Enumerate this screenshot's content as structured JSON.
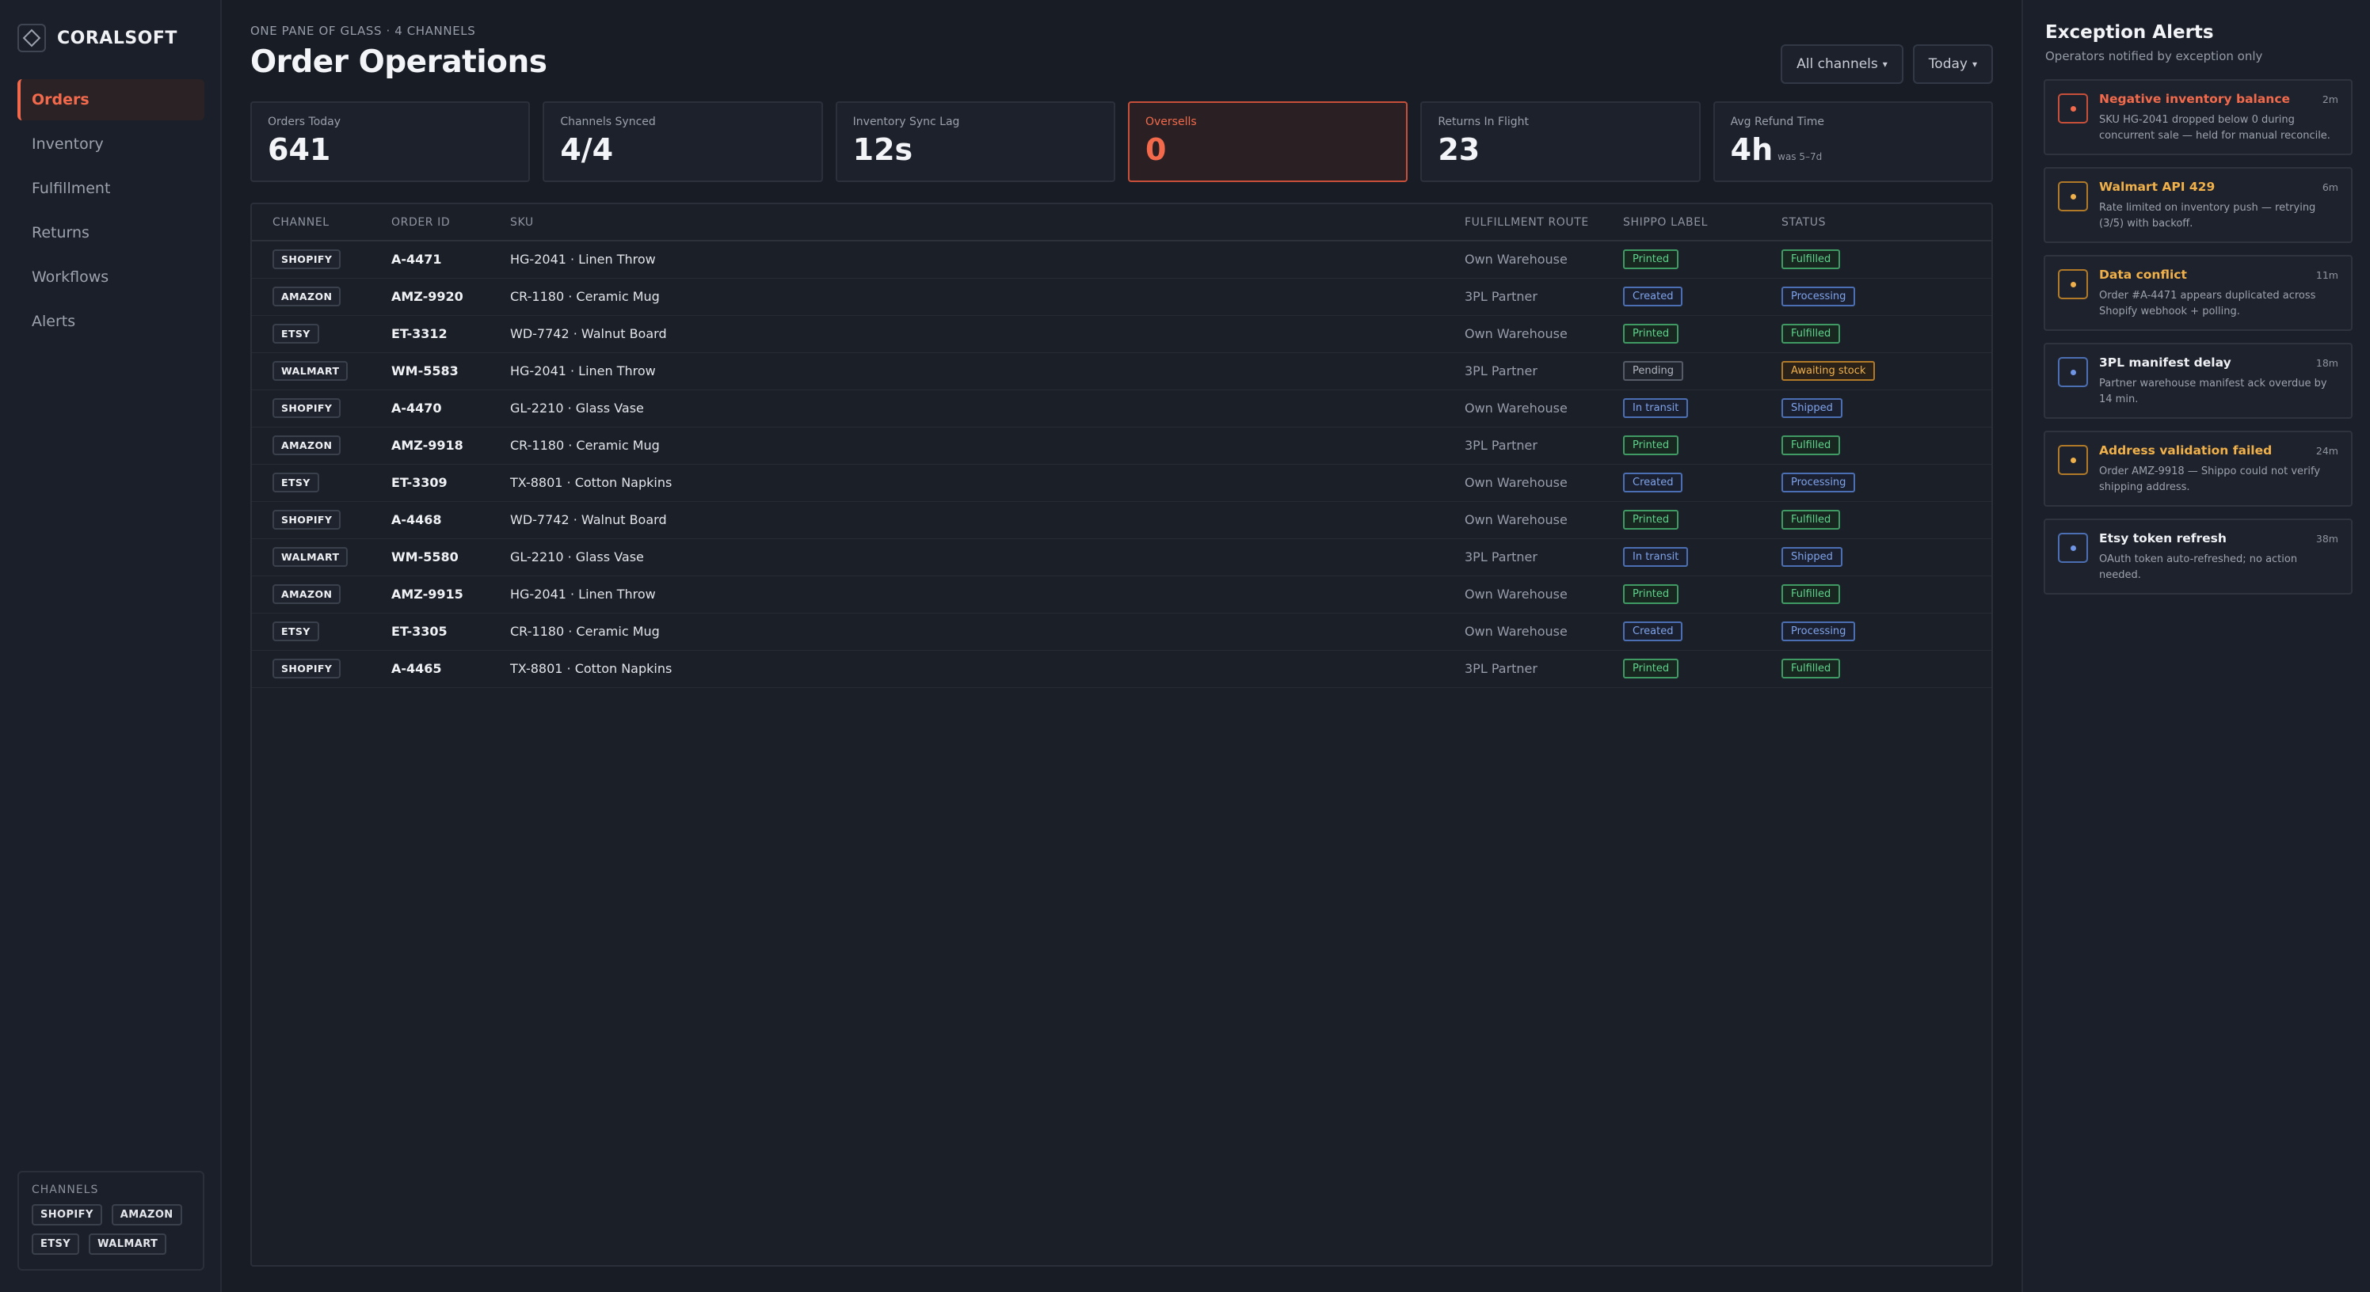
{
  "brand": {
    "name": "CORALSOFT"
  },
  "nav": [
    {
      "label": "Orders",
      "active": true
    },
    {
      "label": "Inventory"
    },
    {
      "label": "Fulfillment"
    },
    {
      "label": "Returns"
    },
    {
      "label": "Workflows"
    },
    {
      "label": "Alerts"
    }
  ],
  "channels_box": {
    "title": "CHANNELS",
    "chips": [
      "SHOPIFY",
      "AMAZON",
      "ETSY",
      "WALMART"
    ]
  },
  "header": {
    "eyebrow": "ONE PANE OF GLASS · 4 CHANNELS",
    "title": "Order Operations",
    "filter_channels": "All channels",
    "filter_date": "Today"
  },
  "kpis": [
    {
      "label": "Orders Today",
      "value": "641"
    },
    {
      "label": "Channels Synced",
      "value": "4/4"
    },
    {
      "label": "Inventory Sync Lag",
      "value": "12s"
    },
    {
      "label": "Oversells",
      "value": "0",
      "alert": true
    },
    {
      "label": "Returns In Flight",
      "value": "23"
    },
    {
      "label": "Avg Refund Time",
      "value": "4h",
      "sub": "was 5–7d"
    }
  ],
  "table": {
    "headers": [
      "CHANNEL",
      "ORDER ID",
      "SKU",
      "FULFILLMENT ROUTE",
      "SHIPPO LABEL",
      "STATUS"
    ],
    "rows": [
      {
        "channel": "SHOPIFY",
        "order_id": "A-4471",
        "sku": "HG-2041 · Linen Throw",
        "route": "Own Warehouse",
        "label": "Printed",
        "status": "Fulfilled"
      },
      {
        "channel": "AMAZON",
        "order_id": "AMZ-9920",
        "sku": "CR-1180 · Ceramic Mug",
        "route": "3PL Partner",
        "label": "Created",
        "status": "Processing"
      },
      {
        "channel": "ETSY",
        "order_id": "ET-3312",
        "sku": "WD-7742 · Walnut Board",
        "route": "Own Warehouse",
        "label": "Printed",
        "status": "Fulfilled"
      },
      {
        "channel": "WALMART",
        "order_id": "WM-5583",
        "sku": "HG-2041 · Linen Throw",
        "route": "3PL Partner",
        "label": "Pending",
        "status": "Awaiting stock"
      },
      {
        "channel": "SHOPIFY",
        "order_id": "A-4470",
        "sku": "GL-2210 · Glass Vase",
        "route": "Own Warehouse",
        "label": "In transit",
        "status": "Shipped"
      },
      {
        "channel": "AMAZON",
        "order_id": "AMZ-9918",
        "sku": "CR-1180 · Ceramic Mug",
        "route": "3PL Partner",
        "label": "Printed",
        "status": "Fulfilled"
      },
      {
        "channel": "ETSY",
        "order_id": "ET-3309",
        "sku": "TX-8801 · Cotton Napkins",
        "route": "Own Warehouse",
        "label": "Created",
        "status": "Processing"
      },
      {
        "channel": "SHOPIFY",
        "order_id": "A-4468",
        "sku": "WD-7742 · Walnut Board",
        "route": "Own Warehouse",
        "label": "Printed",
        "status": "Fulfilled"
      },
      {
        "channel": "WALMART",
        "order_id": "WM-5580",
        "sku": "GL-2210 · Glass Vase",
        "route": "3PL Partner",
        "label": "In transit",
        "status": "Shipped"
      },
      {
        "channel": "AMAZON",
        "order_id": "AMZ-9915",
        "sku": "HG-2041 · Linen Throw",
        "route": "Own Warehouse",
        "label": "Printed",
        "status": "Fulfilled"
      },
      {
        "channel": "ETSY",
        "order_id": "ET-3305",
        "sku": "CR-1180 · Ceramic Mug",
        "route": "Own Warehouse",
        "label": "Created",
        "status": "Processing"
      },
      {
        "channel": "SHOPIFY",
        "order_id": "A-4465",
        "sku": "TX-8801 · Cotton Napkins",
        "route": "3PL Partner",
        "label": "Printed",
        "status": "Fulfilled"
      }
    ]
  },
  "alerts_panel": {
    "title": "Exception Alerts",
    "subtitle": "Operators notified by exception only",
    "items": [
      {
        "severity": "red",
        "title": "Negative inventory balance",
        "time": "2m",
        "desc": "SKU HG-2041 dropped below 0 during concurrent sale — held for manual reconcile."
      },
      {
        "severity": "amber",
        "title": "Walmart API 429",
        "time": "6m",
        "desc": "Rate limited on inventory push — retrying (3/5) with backoff."
      },
      {
        "severity": "amber",
        "title": "Data conflict",
        "time": "11m",
        "desc": "Order #A-4471 appears duplicated across Shopify webhook + polling."
      },
      {
        "severity": "blue",
        "title": "3PL manifest delay",
        "time": "18m",
        "desc": "Partner warehouse manifest ack overdue by 14 min."
      },
      {
        "severity": "amber",
        "title": "Address validation failed",
        "time": "24m",
        "desc": "Order AMZ-9918 — Shippo could not verify shipping address."
      },
      {
        "severity": "blue",
        "title": "Etsy token refresh",
        "time": "38m",
        "desc": "OAuth token auto-refreshed; no action needed."
      }
    ]
  },
  "colors": {
    "accent": "#f26a4b",
    "success": "#5fd38c",
    "info": "#7fa3ea",
    "warning": "#f0b04a",
    "background": "#181c25"
  }
}
